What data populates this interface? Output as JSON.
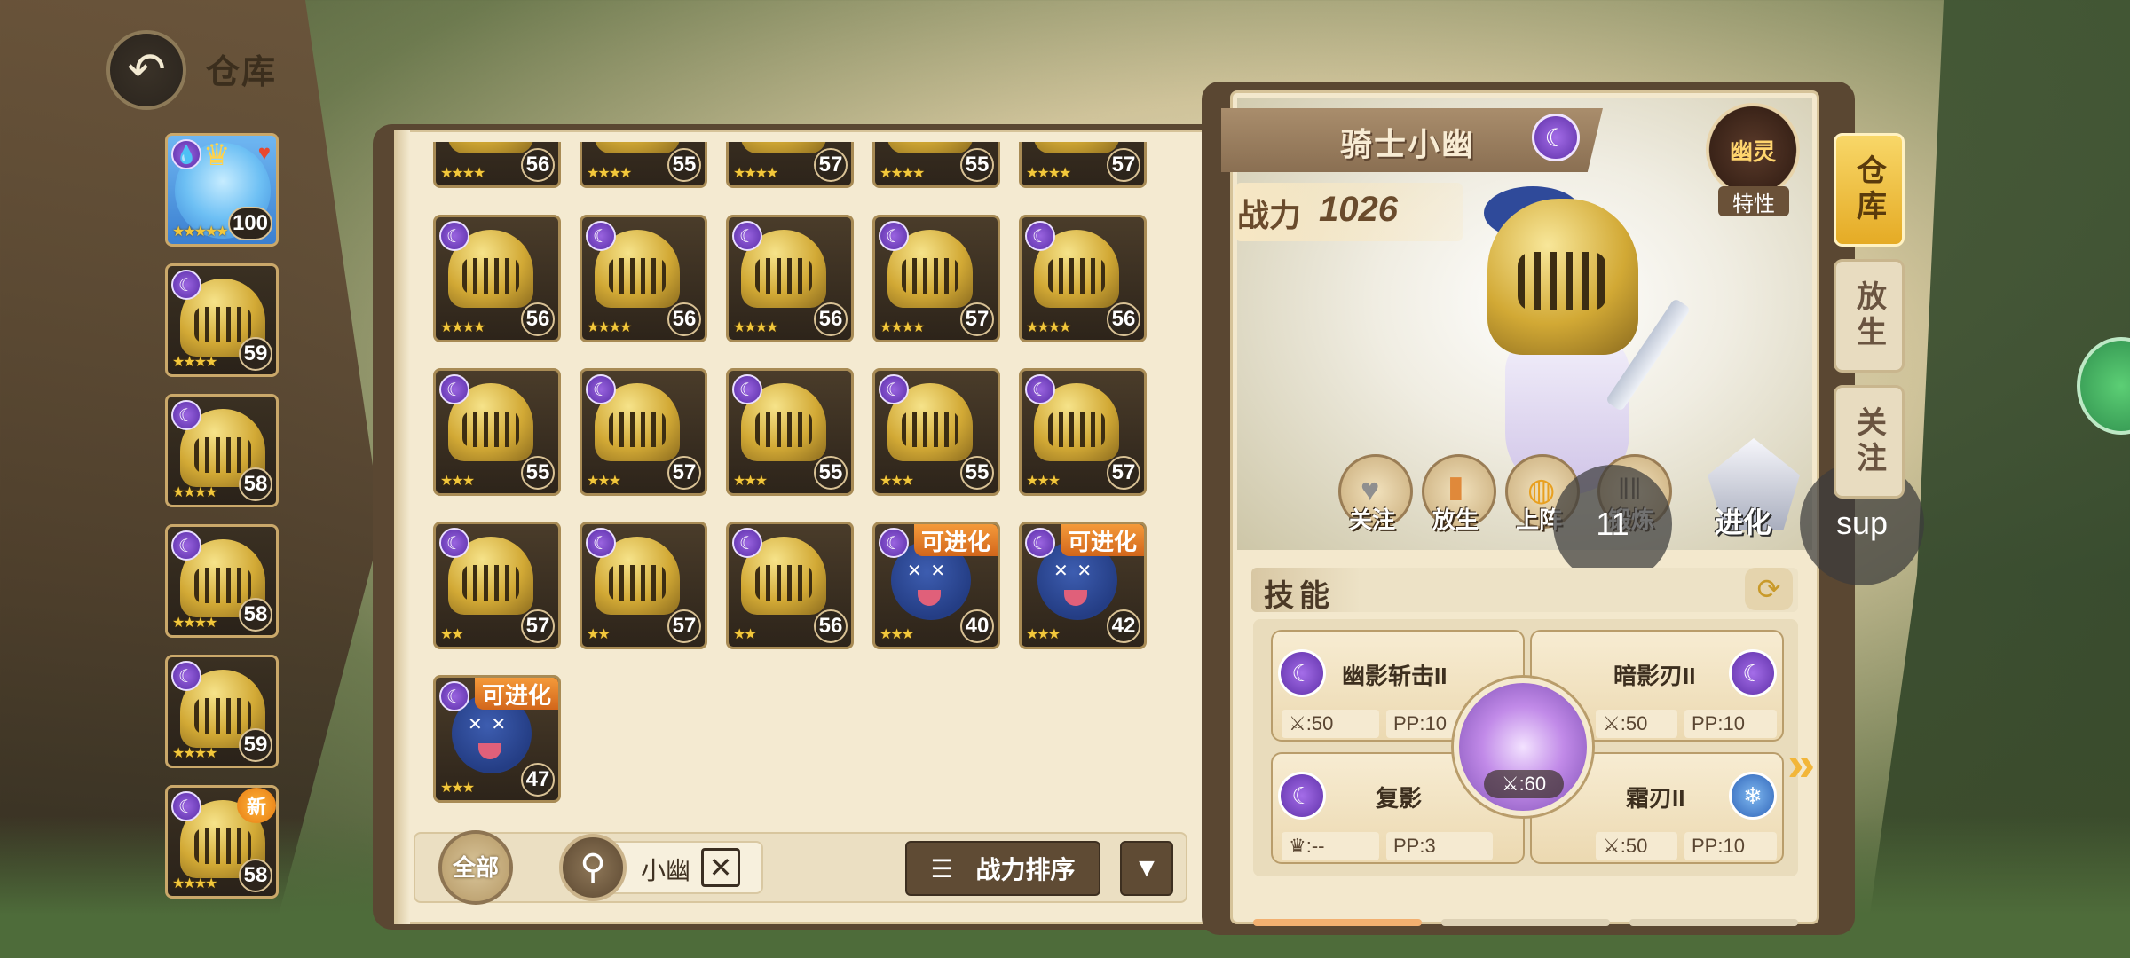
{
  "header": {
    "title": "仓库",
    "back_icon": "back-arrow-icon"
  },
  "team": [
    {
      "type": "fairy",
      "level": "100",
      "stars": "★★★★★",
      "badge": "crown-heart"
    },
    {
      "type": "knight",
      "level": "59",
      "stars": "★★★★"
    },
    {
      "type": "knight",
      "level": "58",
      "stars": "★★★★"
    },
    {
      "type": "knight",
      "level": "58",
      "stars": "★★★★"
    },
    {
      "type": "knight",
      "level": "59",
      "stars": "★★★★"
    },
    {
      "type": "knight",
      "level": "58",
      "stars": "★★★★",
      "tag": "新"
    }
  ],
  "storage": {
    "cards": [
      {
        "type": "knight",
        "level": "56",
        "stars": "★★★★"
      },
      {
        "type": "knight",
        "level": "55",
        "stars": "★★★★"
      },
      {
        "type": "knight",
        "level": "57",
        "stars": "★★★★"
      },
      {
        "type": "knight",
        "level": "55",
        "stars": "★★★★"
      },
      {
        "type": "knight",
        "level": "57",
        "stars": "★★★★"
      },
      {
        "type": "knight",
        "level": "56",
        "stars": "★★★★"
      },
      {
        "type": "knight",
        "level": "56",
        "stars": "★★★★"
      },
      {
        "type": "knight",
        "level": "56",
        "stars": "★★★★"
      },
      {
        "type": "knight",
        "level": "57",
        "stars": "★★★★"
      },
      {
        "type": "knight",
        "level": "56",
        "stars": "★★★★"
      },
      {
        "type": "knight",
        "level": "55",
        "stars": "★★★"
      },
      {
        "type": "knight",
        "level": "57",
        "stars": "★★★"
      },
      {
        "type": "knight",
        "level": "55",
        "stars": "★★★"
      },
      {
        "type": "knight",
        "level": "55",
        "stars": "★★★"
      },
      {
        "type": "knight",
        "level": "57",
        "stars": "★★★"
      },
      {
        "type": "knight",
        "level": "57",
        "stars": "★★"
      },
      {
        "type": "knight",
        "level": "57",
        "stars": "★★"
      },
      {
        "type": "knight",
        "level": "56",
        "stars": "★★"
      },
      {
        "type": "ghost",
        "level": "40",
        "stars": "★★★",
        "tag": "可进化"
      },
      {
        "type": "ghost",
        "level": "42",
        "stars": "★★★",
        "tag": "可进化"
      },
      {
        "type": "ghost",
        "level": "47",
        "stars": "★★★",
        "tag": "可进化"
      }
    ]
  },
  "toolbar": {
    "filter_all": "全部",
    "search_value": "小幽",
    "clear_icon": "close-box-icon",
    "sort_label": "战力排序",
    "sort_icon": "menu-lines-icon",
    "dropdown_icon": "triangle-down-icon"
  },
  "detail": {
    "name": "骑士小幽",
    "element_icon": "moon-icon",
    "power_label": "战力",
    "power_value": "1026",
    "trait_badge": "幽灵",
    "trait_label": "特性",
    "actions": [
      {
        "label": "关注",
        "icon": "heart-icon"
      },
      {
        "label": "放生",
        "icon": "door-icon"
      },
      {
        "label": "上阵",
        "icon": "ball-icon"
      },
      {
        "label": "锻炼",
        "icon": "dumbbell-icon"
      }
    ],
    "evolve_label": "进化",
    "skills_title": "技能",
    "skills": [
      {
        "name": "幽影斩击II",
        "power": ":50",
        "pp": "PP:10",
        "element": "ghost"
      },
      {
        "name": "暗影刃II",
        "power": ":50",
        "pp": "PP:10",
        "element": "ghost"
      },
      {
        "name": "复影",
        "power": ":--",
        "pp": "PP:3",
        "element": "ghost"
      },
      {
        "name": "霜刃II",
        "power": ":50",
        "pp": "PP:10",
        "element": "ice"
      }
    ],
    "center_skill_value": ":60"
  },
  "side_tabs": [
    {
      "label": "仓库",
      "active": true
    },
    {
      "label": "放生",
      "active": false
    },
    {
      "label": "关注",
      "active": false
    }
  ],
  "overlay": {
    "left": "11",
    "right": "sup"
  }
}
